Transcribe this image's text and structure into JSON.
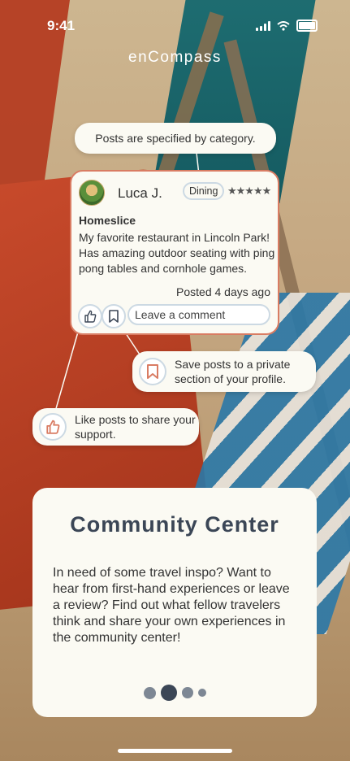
{
  "status_bar": {
    "time": "9:41"
  },
  "brand": "enCompass",
  "callouts": {
    "category": "Posts are specified by category.",
    "save": "Save posts to a private section of your profile.",
    "like": "Like posts to share your support."
  },
  "post": {
    "author": "Luca J.",
    "category": "Dining",
    "rating_stars": "★★★★★",
    "title": "Homeslice",
    "body": "My favorite restaurant in Lincoln Park! Has amazing outdoor seating with ping pong tables and cornhole games.",
    "posted": "Posted 4 days ago",
    "comment_placeholder": "Leave a comment"
  },
  "card": {
    "title": "Community Center",
    "body": "In need of some travel inspo? Want to hear from first-hand experiences or leave a review? Find out what fellow travelers think and share your own experiences in the community center!"
  },
  "pager": {
    "total": 4,
    "active_index": 1
  },
  "colors": {
    "accent_orange": "#d97c63",
    "navy": "#3b4656",
    "card_bg": "#fbfaf3",
    "outline_blue": "#ccd9e3"
  }
}
